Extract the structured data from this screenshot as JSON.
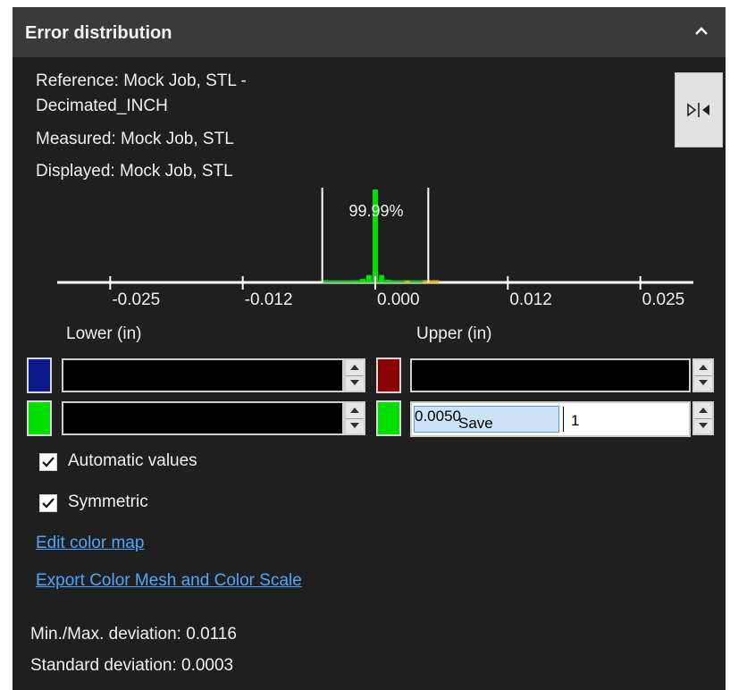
{
  "panel": {
    "title": "Error distribution",
    "collapse_icon": "chevron-up-icon"
  },
  "info": {
    "reference_line1": "Reference: Mock Job, STL -",
    "reference_line2": "Decimated_INCH",
    "measured": "Measured: Mock Job, STL",
    "displayed": "Displayed: Mock Job, STL",
    "symmetric_button_icon": "split-arrows-icon"
  },
  "histogram": {
    "percent_label": "99.99%",
    "tick_labels": [
      "-0.025",
      "-0.012",
      "0.000",
      "0.012",
      "0.025"
    ],
    "ticks": [
      -0.025,
      -0.0125,
      0,
      0.0125,
      0.025
    ],
    "range": [
      -0.03,
      0.03
    ],
    "lower_limit": -0.005,
    "upper_limit": 0.005,
    "bars": [
      {
        "x": -0.0018,
        "height": 0.02,
        "color": "#00e000"
      },
      {
        "x": -0.0012,
        "height": 0.04,
        "color": "#00e000"
      },
      {
        "x": -0.0006,
        "height": 0.08,
        "color": "#00e000"
      },
      {
        "x": 0.0,
        "height": 1.0,
        "color": "#00e000"
      },
      {
        "x": 0.0006,
        "height": 0.08,
        "color": "#00e000"
      },
      {
        "x": 0.0012,
        "height": 0.03,
        "color": "#00e000"
      },
      {
        "x": 0.003,
        "height": 0.01,
        "color": "#e0b000"
      }
    ],
    "baseline_segments": [
      {
        "from": -0.005,
        "to": 0.0045,
        "color": "#2fb52f"
      },
      {
        "from": 0.0045,
        "to": 0.006,
        "color": "#e0b000"
      }
    ]
  },
  "limits": {
    "lower_label": "Lower (in)",
    "upper_label": "Upper (in)",
    "lower_row1_color": "#0a1a8a",
    "lower_row2_color": "#00e000",
    "upper_row1_color": "#8b0000",
    "upper_row2_color": "#00e000",
    "lower_row1_value": "",
    "lower_row2_value": "",
    "upper_row1_value": "",
    "upper_edit_value": "0.0050",
    "upper_edit_overlay": "Save",
    "upper_edit_suffix": "1"
  },
  "options": {
    "automatic_values": "Automatic values",
    "automatic_checked": true,
    "symmetric": "Symmetric",
    "symmetric_checked": true
  },
  "links": {
    "edit_color_map": "Edit color map",
    "export": "Export Color Mesh and Color Scale"
  },
  "stats": {
    "minmax": "Min./Max. deviation: 0.0116",
    "std": "Standard deviation: 0.0003"
  }
}
